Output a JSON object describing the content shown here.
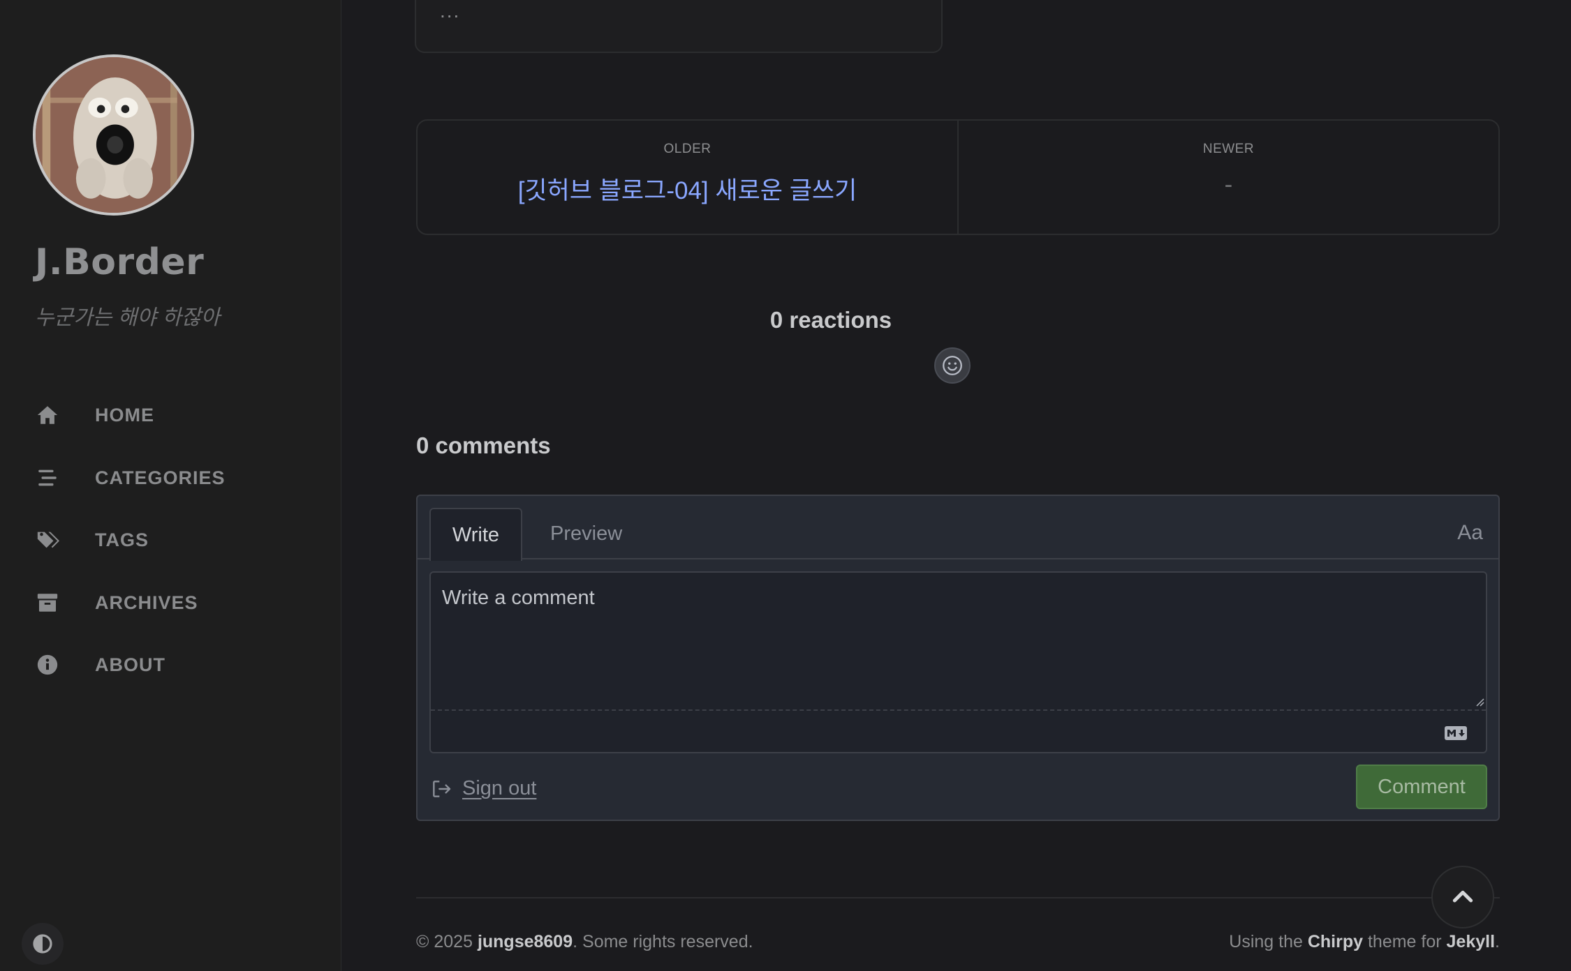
{
  "sidebar": {
    "site_title": "J.Border",
    "site_subtitle": "누군가는 해야 하잖아",
    "nav": [
      {
        "label": "HOME",
        "icon": "home-icon"
      },
      {
        "label": "CATEGORIES",
        "icon": "stream-icon"
      },
      {
        "label": "TAGS",
        "icon": "tags-icon"
      },
      {
        "label": "ARCHIVES",
        "icon": "archive-icon"
      },
      {
        "label": "ABOUT",
        "icon": "info-circle-icon"
      }
    ],
    "theme_toggle_icon": "adjust-icon"
  },
  "post": {
    "excerpt_ellipsis": "..."
  },
  "post_nav": {
    "older_label": "OLDER",
    "older_title": "[깃허브 블로그-04] 새로운 글쓰기",
    "newer_label": "NEWER",
    "newer_title": "-"
  },
  "reactions": {
    "count_text": "0 reactions",
    "icon": "smiley-icon"
  },
  "comments": {
    "count_text": "0 comments",
    "tab_write": "Write",
    "tab_preview": "Preview",
    "font_toggle": "Aa",
    "placeholder": "Write a comment",
    "markdown_icon": "markdown-icon",
    "sign_out": "Sign out",
    "submit": "Comment"
  },
  "footer": {
    "copyright_prefix": "© 2025 ",
    "author": "jungse8609",
    "rights": ". Some rights reserved.",
    "using": "Using the ",
    "theme": "Chirpy",
    "theme_for": " theme for ",
    "engine": "Jekyll",
    "end": "."
  },
  "colors": {
    "background": "#1b1b1e",
    "link": "#8aa7ff",
    "submit_button": "#3f6a38"
  }
}
